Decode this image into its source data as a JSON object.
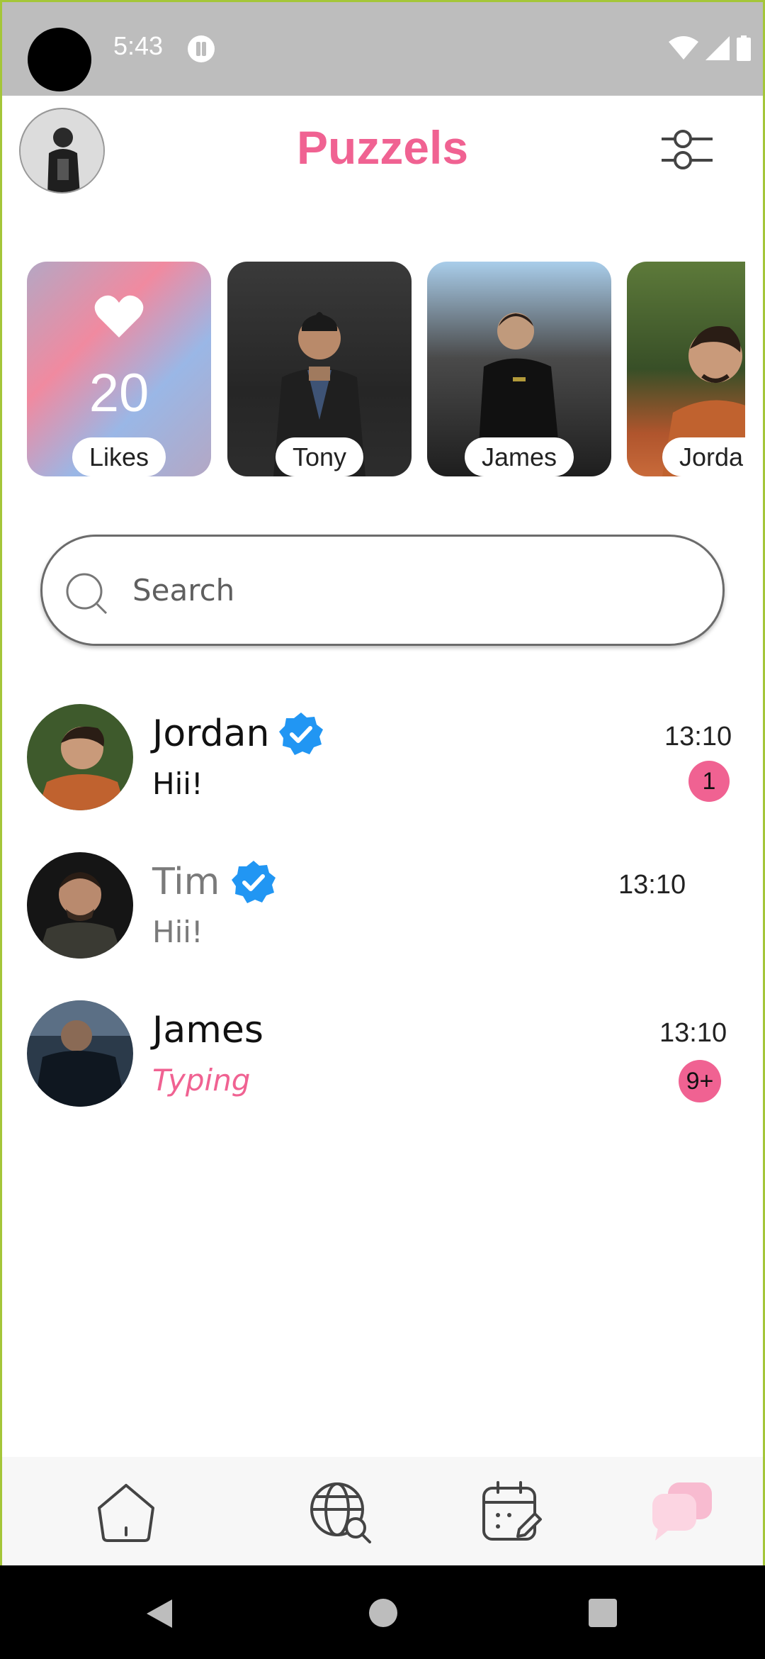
{
  "status_bar": {
    "time": "5:43"
  },
  "header": {
    "title": "Puzzels"
  },
  "stories": {
    "likes": {
      "count": "20",
      "label": "Likes"
    },
    "items": [
      {
        "label": "Tony"
      },
      {
        "label": "James"
      },
      {
        "label": "Jorda"
      }
    ]
  },
  "search": {
    "placeholder": "Search"
  },
  "chats": [
    {
      "name": "Jordan",
      "verified": true,
      "message": "Hii!",
      "time": "13:10",
      "unread": "1"
    },
    {
      "name": "Tim",
      "verified": true,
      "message": "Hii!",
      "time": "13:10",
      "unread": ""
    },
    {
      "name": "James",
      "verified": false,
      "message": "Typing",
      "time": "13:10",
      "unread": "9+"
    }
  ],
  "bottom_nav": {
    "items": [
      {
        "icon": "home-icon"
      },
      {
        "icon": "globe-search-icon"
      },
      {
        "icon": "calendar-edit-icon"
      },
      {
        "icon": "chat-bubbles-icon",
        "active": true
      }
    ]
  },
  "colors": {
    "accent": "#f06292",
    "verified": "#2196f3",
    "status_bar": "#bdbdbd"
  }
}
